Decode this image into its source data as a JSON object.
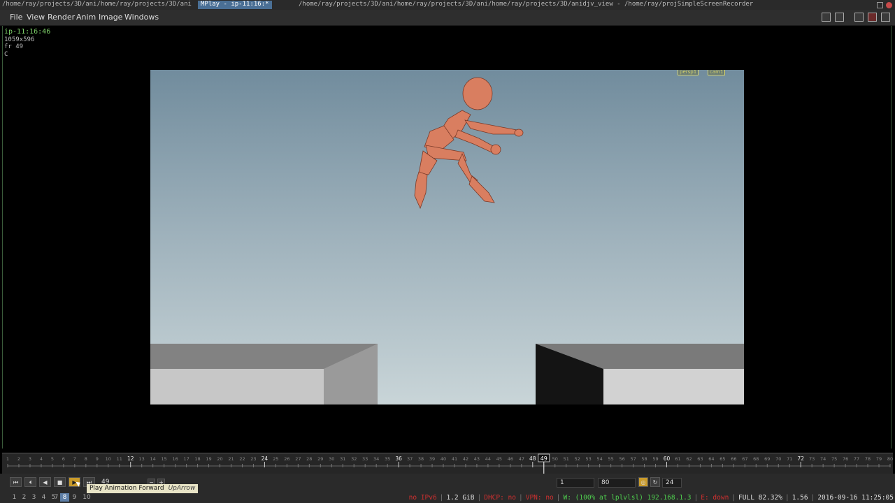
{
  "titlebar": {
    "path_left": "/home/ray/projects/3D/ani/home/ray/projects/3D/ani",
    "active_title": "MPlay - ip-11:16:*",
    "path_right": "/home/ray/projects/3D/ani/home/ray/projects/3D/ani/home/ray/projects/3D/anidjv_view - /home/ray/projSimpleScreenRecorder"
  },
  "menu": [
    "File",
    "View",
    "Render",
    "Anim",
    "Image",
    "Windows"
  ],
  "info": {
    "name": "ip-11:16:46",
    "resolution": "1059x596",
    "frame": "fr 49",
    "channel": "C"
  },
  "viewport": {
    "tag_left": "persp1",
    "tag_right": "cam1"
  },
  "timeline": {
    "start": 1,
    "end": 80,
    "current": 49,
    "major_ticks": [
      12,
      24,
      36,
      48,
      60,
      72
    ]
  },
  "playbar": {
    "frame_value": "49",
    "range_start": "1",
    "range_end": "80",
    "fps": "24",
    "tooltip_label": "Play Animation Forward",
    "tooltip_shortcut": "UpArrow"
  },
  "desktops": [
    "1",
    "2",
    "3",
    "4",
    "5",
    "7",
    "8",
    "9",
    "10"
  ],
  "desktop_active": "8",
  "status": [
    {
      "text": "no IPv6",
      "color": "#d03030"
    },
    {
      "text": "1.2 GiB",
      "color": "#e0e0e0"
    },
    {
      "text": "DHCP: no",
      "color": "#d03030"
    },
    {
      "text": "VPN: no",
      "color": "#d03030"
    },
    {
      "text": "W: (100% at lplvlsl) 192.168.1.3",
      "color": "#4fd04f"
    },
    {
      "text": "E: down",
      "color": "#d03030"
    },
    {
      "text": "FULL 82.32%",
      "color": "#e0e0e0"
    },
    {
      "text": "1.56",
      "color": "#e0e0e0"
    },
    {
      "text": "2016-09-16 11:25:05",
      "color": "#e0e0e0"
    }
  ],
  "colors": {
    "accent": "#c99a2a",
    "character": "#d97e60",
    "sky_top": "#718c9d",
    "sky_bottom": "#c9d5d8"
  }
}
